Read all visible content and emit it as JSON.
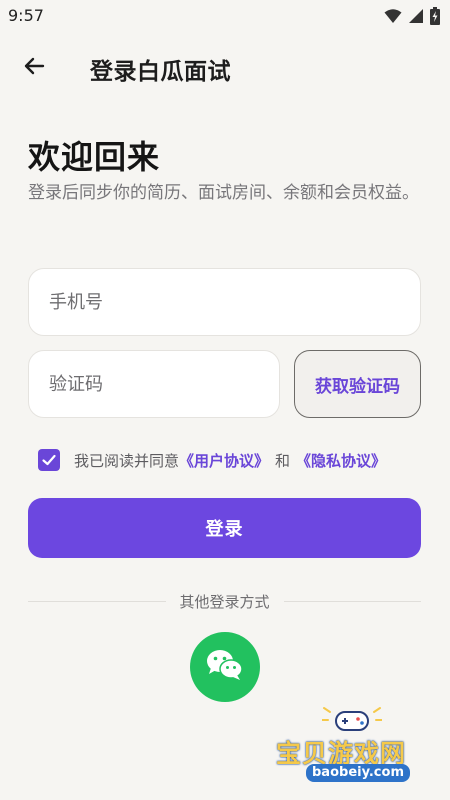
{
  "status_bar": {
    "time": "9:57",
    "icons": [
      "wifi-icon",
      "cell-signal-icon",
      "battery-charging-icon"
    ]
  },
  "appbar": {
    "back_icon": "arrow-left-icon",
    "title": "登录白瓜面试"
  },
  "welcome": {
    "title": "欢迎回来",
    "subtitle": "登录后同步你的简历、面试房间、余额和会员权益。"
  },
  "form": {
    "phone_placeholder": "手机号",
    "code_placeholder": "验证码",
    "get_code_label": "获取验证码"
  },
  "agreement": {
    "checked": true,
    "prefix": "我已阅读并同意",
    "user_agreement": "《用户协议》",
    "and": "和",
    "privacy_policy": "《隐私协议》"
  },
  "login_button": "登录",
  "other_login": {
    "label": "其他登录方式",
    "wechat_icon": "wechat-icon"
  },
  "watermark": {
    "name": "宝贝游戏网",
    "url": "baobeiy.com"
  },
  "colors": {
    "accent": "#6c47e0",
    "link": "#6a46d8",
    "wechat": "#22c15f",
    "background": "#f6f5f2"
  }
}
